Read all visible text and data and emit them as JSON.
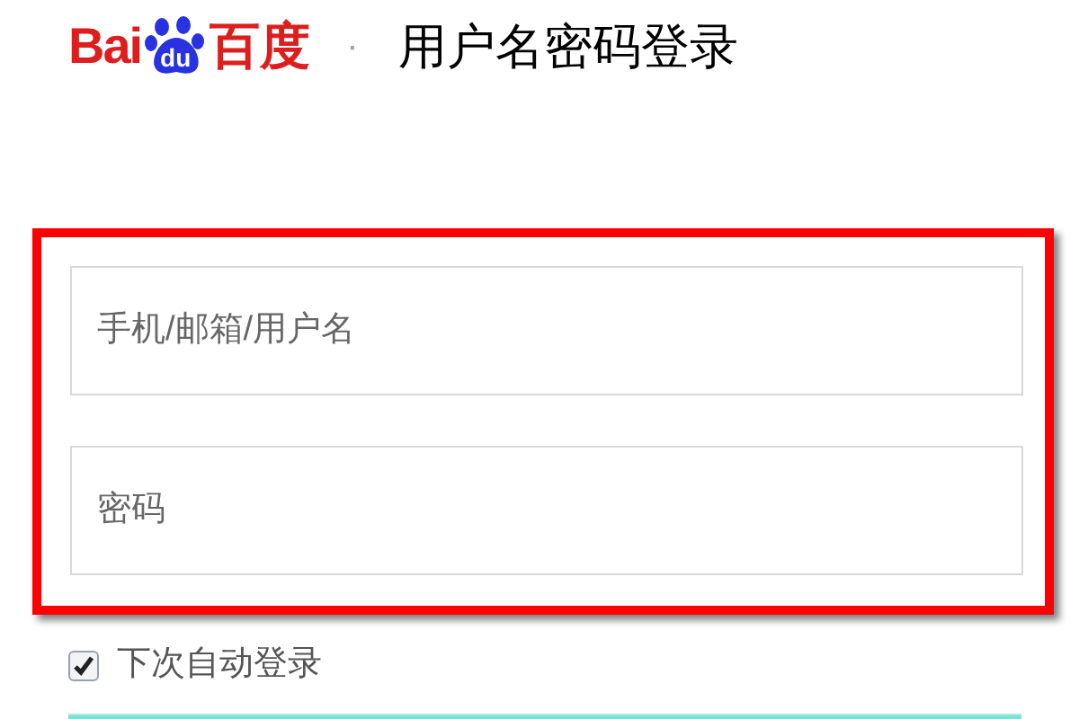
{
  "logo": {
    "parts": [
      "Bai",
      "du",
      "百度"
    ]
  },
  "separator": "·",
  "title": "用户名密码登录",
  "fields": [
    {
      "placeholder": "手机/邮箱/用户名"
    },
    {
      "placeholder": "密码"
    }
  ],
  "remember": {
    "label": "下次自动登录",
    "checked": true
  },
  "highlight": {
    "color": "#ff0000"
  }
}
